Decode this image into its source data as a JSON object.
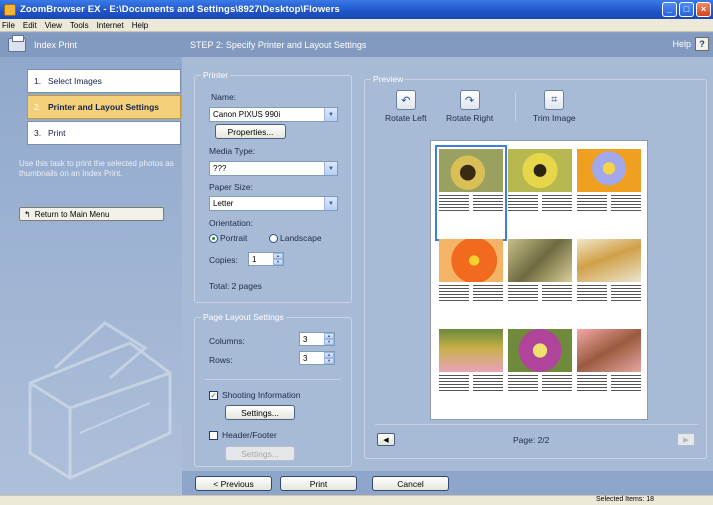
{
  "window": {
    "title": "ZoomBrowser EX  -  E:\\Documents and Settings\\8927\\Desktop\\Flowers"
  },
  "menu": [
    "File",
    "Edit",
    "View",
    "Tools",
    "Internet",
    "Help"
  ],
  "left": {
    "header": "Index Print",
    "steps": [
      {
        "num": "1.",
        "label": "Select Images"
      },
      {
        "num": "2.",
        "label": "Printer and Layout Settings"
      },
      {
        "num": "3.",
        "label": "Print"
      }
    ],
    "description": "Use this task to print the selected photos as thumbnails on an Index Print.",
    "return_label": "Return to Main Menu"
  },
  "main": {
    "header": "STEP 2: Specify Printer and Layout Settings",
    "help_label": "Help",
    "help_icon": "?",
    "printer": {
      "title": "Printer",
      "name_label": "Name:",
      "name_value": "Canon PIXUS 990i",
      "properties_label": "Properties...",
      "media_label": "Media Type:",
      "media_value": "???",
      "paper_label": "Paper Size:",
      "paper_value": "Letter",
      "orientation_label": "Orientation:",
      "portrait_label": "Portrait",
      "landscape_label": "Landscape",
      "copies_label": "Copies:",
      "copies_value": "1",
      "total_label": "Total: 2 pages"
    },
    "layout": {
      "title": "Page Layout Settings",
      "columns_label": "Columns:",
      "columns_value": "3",
      "rows_label": "Rows:",
      "rows_value": "3",
      "shooting_label": "Shooting Information",
      "shooting_settings": "Settings...",
      "header_label": "Header/Footer",
      "header_settings": "Settings..."
    },
    "preview": {
      "title": "Preview",
      "rotate_left": "Rotate Left",
      "rotate_right": "Rotate Right",
      "trim": "Trim Image",
      "page_label": "Page: 2/2"
    }
  },
  "bottom": {
    "previous": "< Previous",
    "print": "Print",
    "cancel": "Cancel"
  },
  "status": {
    "selected": "Selected Items: 18"
  }
}
